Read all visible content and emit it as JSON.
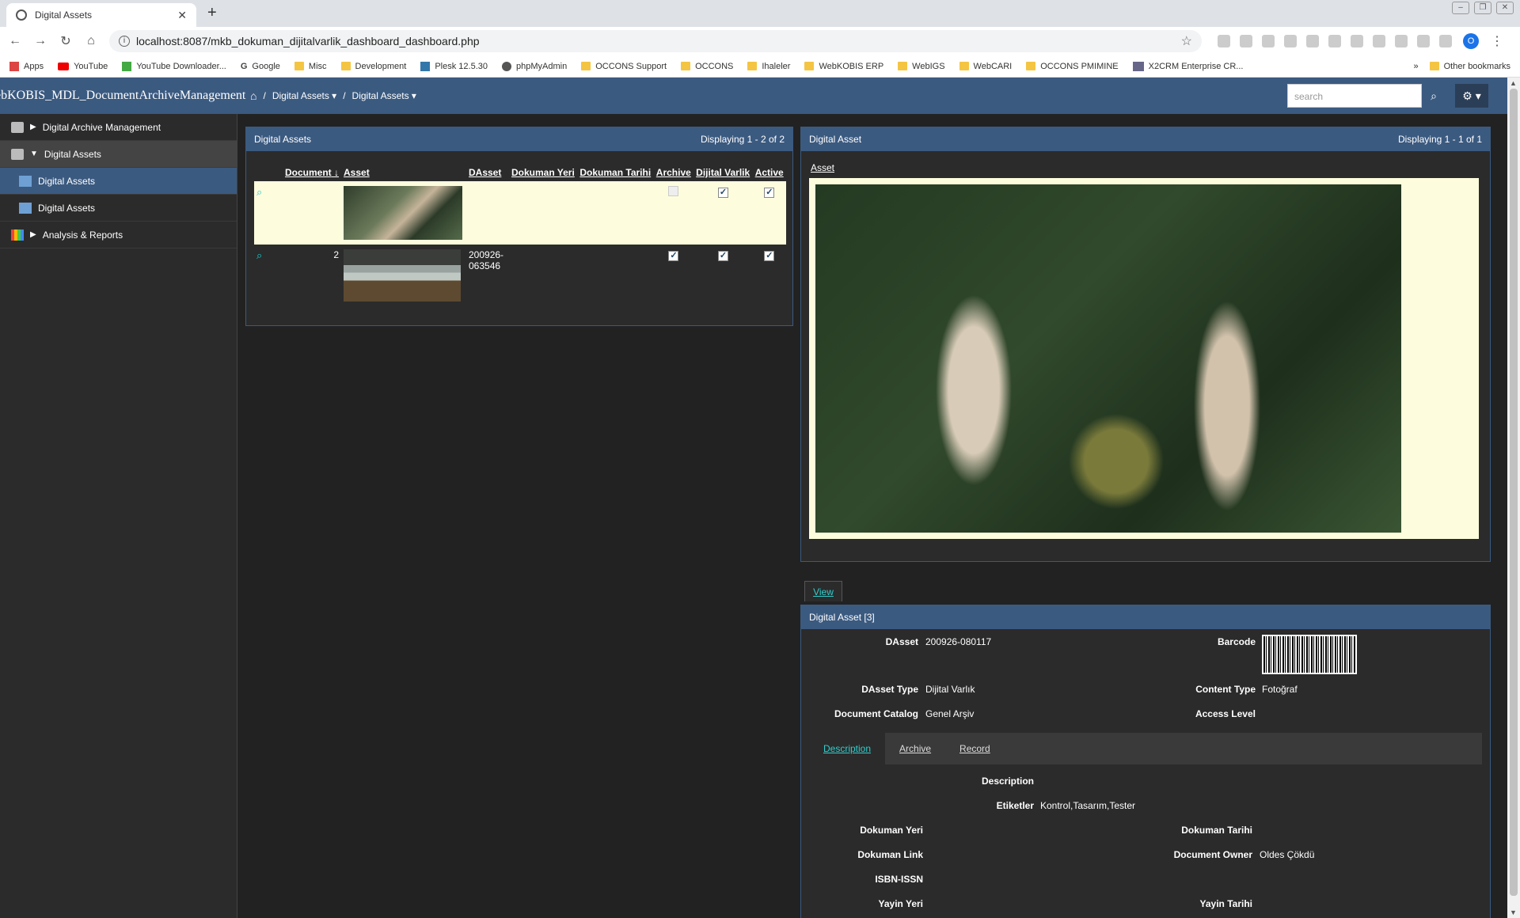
{
  "browser": {
    "tab_title": "Digital Assets",
    "url": "localhost:8087/mkb_dokuman_dijitalvarlik_dashboard_dashboard.php",
    "bookmarks": [
      "Apps",
      "YouTube",
      "YouTube Downloader...",
      "Google",
      "Misc",
      "Development",
      "Plesk 12.5.30",
      "phpMyAdmin",
      "OCCONS Support",
      "OCCONS",
      "Ihaleler",
      "WebKOBIS ERP",
      "WebIGS",
      "WebCARI",
      "OCCONS PMIMINE",
      "X2CRM Enterprise CR..."
    ],
    "bookmarks_more": "»",
    "other_bookmarks": "Other bookmarks",
    "profile_initial": "O"
  },
  "header": {
    "app_name": "ebKOBIS_MDL_DocumentArchiveManagement",
    "crumb1": "Digital Assets",
    "crumb2": "Digital Assets",
    "search_placeholder": "search"
  },
  "sidebar": {
    "items": [
      {
        "label": "Digital Archive Management"
      },
      {
        "label": "Digital Assets"
      },
      {
        "label": "Digital Assets"
      },
      {
        "label": "Digital Assets"
      },
      {
        "label": "Analysis & Reports"
      }
    ]
  },
  "list_panel": {
    "title": "Digital Assets",
    "displaying": "Displaying 1 - 2 of 2",
    "columns": [
      "Document",
      "Asset",
      "DAsset",
      "Dokuman Yeri",
      "Dokuman Tarihi",
      "Archive",
      "Dijital Varlik",
      "Active"
    ],
    "rows": [
      {
        "document": "",
        "dasset": "",
        "archive": false,
        "dijital": true,
        "active": true
      },
      {
        "document": "2",
        "dasset": "200926-063546",
        "archive": true,
        "dijital": true,
        "active": true
      }
    ]
  },
  "asset_panel": {
    "title": "Digital Asset",
    "displaying": "Displaying 1 - 1 of 1",
    "asset_label": "Asset"
  },
  "detail": {
    "view_tab": "View",
    "title": "Digital Asset [3]",
    "dasset_label": "DAsset",
    "dasset_value": "200926-080117",
    "barcode_label": "Barcode",
    "dasset_type_label": "DAsset Type",
    "dasset_type_value": "Dijital Varlık",
    "content_type_label": "Content Type",
    "content_type_value": "Fotoğraf",
    "doc_catalog_label": "Document Catalog",
    "doc_catalog_value": "Genel Arşiv",
    "access_level_label": "Access Level",
    "tabs": [
      "Description",
      "Archive",
      "Record"
    ],
    "description_label": "Description",
    "etiketler_label": "Etiketler",
    "etiketler_value": "Kontrol,Tasarım,Tester",
    "dokuman_yeri_label": "Dokuman Yeri",
    "dokuman_tarihi_label": "Dokuman Tarihi",
    "dokuman_link_label": "Dokuman Link",
    "doc_owner_label": "Document Owner",
    "doc_owner_value": "Oldes Çökdü",
    "isbn_label": "ISBN-ISSN",
    "yayin_yeri_label": "Yayin Yeri",
    "yayin_tarihi_label": "Yayin Tarihi"
  }
}
